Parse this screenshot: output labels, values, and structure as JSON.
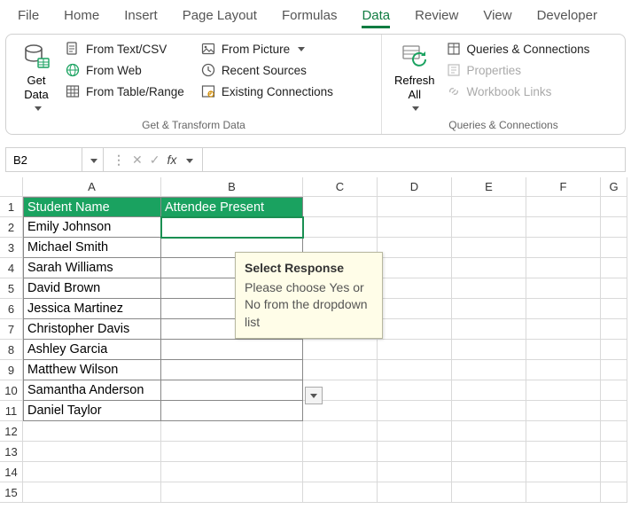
{
  "tabs": [
    "File",
    "Home",
    "Insert",
    "Page Layout",
    "Formulas",
    "Data",
    "Review",
    "View",
    "Developer"
  ],
  "active_tab": "Data",
  "ribbon": {
    "group1": {
      "get_data": "Get\nData",
      "cmds": [
        "From Text/CSV",
        "From Web",
        "From Table/Range",
        "From Picture",
        "Recent Sources",
        "Existing Connections"
      ],
      "label": "Get & Transform Data"
    },
    "group2": {
      "refresh_all": "Refresh\nAll",
      "cmds": [
        "Queries & Connections",
        "Properties",
        "Workbook Links"
      ],
      "label": "Queries & Connections"
    }
  },
  "namebox": "B2",
  "fx": "fx",
  "columns": [
    "A",
    "B",
    "C",
    "D",
    "E",
    "F",
    "G"
  ],
  "headers": {
    "A": "Student Name",
    "B": "Attendee Present"
  },
  "students": [
    "Emily Johnson",
    "Michael Smith",
    "Sarah Williams",
    "David Brown",
    "Jessica Martinez",
    "Christopher Davis",
    "Ashley Garcia",
    "Matthew Wilson",
    "Samantha Anderson",
    "Daniel Taylor"
  ],
  "tooltip": {
    "title": "Select Response",
    "body": "Please choose Yes or No from the dropdown list"
  }
}
